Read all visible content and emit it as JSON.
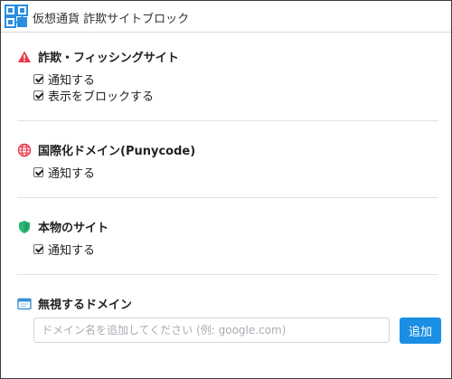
{
  "window": {
    "title": "仮想通貨 詐欺サイトブロック"
  },
  "sections": {
    "phishing": {
      "title": "詐欺・フィッシングサイト",
      "icon": "warning-icon",
      "icon_color": "#e8374a",
      "options": [
        {
          "label": "通知する",
          "checked": true
        },
        {
          "label": "表示をブロックする",
          "checked": true
        }
      ]
    },
    "punycode": {
      "title": "国際化ドメイン(Punycode)",
      "icon": "globe-icon",
      "icon_color": "#e8374a",
      "options": [
        {
          "label": "通知する",
          "checked": true
        }
      ]
    },
    "genuine": {
      "title": "本物のサイト",
      "icon": "shield-icon",
      "icon_color": "#2bb673",
      "options": [
        {
          "label": "通知する",
          "checked": true
        }
      ]
    },
    "ignore": {
      "title": "無視するドメイン",
      "icon": "browser-window-icon",
      "icon_color": "#3b8fd9",
      "input_placeholder": "ドメイン名を追加してください (例: google.com)",
      "input_value": "",
      "add_label": "追加"
    }
  },
  "colors": {
    "accent": "#1a8fe3",
    "logo": "#2a8de0"
  }
}
